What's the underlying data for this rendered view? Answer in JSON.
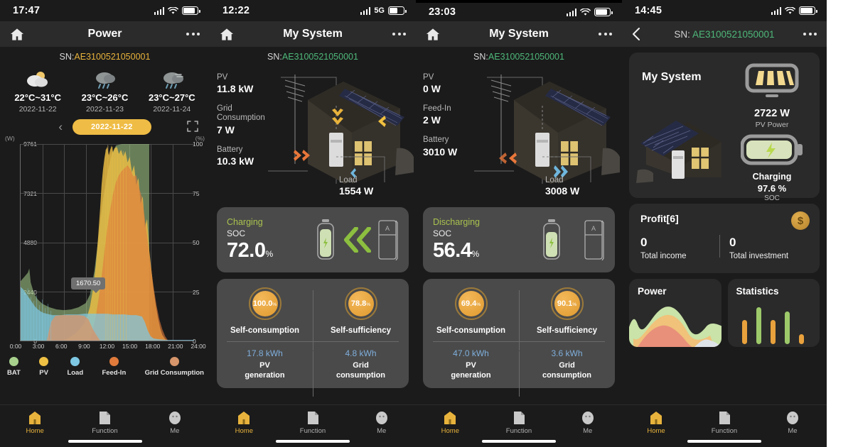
{
  "panels": {
    "power": {
      "status": {
        "time": "17:47",
        "network": "",
        "wifi": true
      },
      "nav": {
        "title": "Power",
        "home_icon": "home-icon",
        "more_icon": "more-icon"
      },
      "sn": {
        "label": "SN:",
        "value": "AE3100521050001"
      },
      "weather": [
        {
          "icon": "partly-cloudy-icon",
          "temp": "22°C~31°C",
          "date": "2022-11-22"
        },
        {
          "icon": "rain-icon",
          "temp": "23°C~26°C",
          "date": "2022-11-23"
        },
        {
          "icon": "rain-wind-icon",
          "temp": "23°C~27°C",
          "date": "2022-11-24"
        }
      ],
      "date_selector": {
        "prev_icon": "chevron-left-icon",
        "value": "2022-11-22",
        "expand_icon": "expand-icon"
      },
      "axis_left_unit": "(W)",
      "axis_right_unit": "(%)",
      "tooltip": "1670.50",
      "legend": [
        {
          "name": "BAT",
          "color": "#a8d08d"
        },
        {
          "name": "PV",
          "color": "#eec044"
        },
        {
          "name": "Load",
          "color": "#7ec8e3"
        },
        {
          "name": "Feed-In",
          "color": "#e07b3c"
        },
        {
          "name": "Grid Consumption",
          "color": "#d6956a"
        }
      ],
      "tabs": [
        {
          "label": "Home",
          "icon": "home-icon",
          "active": true
        },
        {
          "label": "Function",
          "icon": "document-icon",
          "active": false
        },
        {
          "label": "Me",
          "icon": "person-icon",
          "active": false
        }
      ]
    },
    "system_charging": {
      "status": {
        "time": "12:22",
        "network": "5G"
      },
      "nav": {
        "title": "My System"
      },
      "sn": {
        "label": "SN:",
        "value": "AE3100521050001"
      },
      "metrics": [
        {
          "key": "PV",
          "value": "11.8 kW"
        },
        {
          "key": "Grid Consumption",
          "value": "7 W"
        },
        {
          "key": "Battery",
          "value": "10.3 kW"
        }
      ],
      "load": {
        "key": "Load",
        "value": "1554 W"
      },
      "battery_card": {
        "state": "Charging",
        "label": "SOC",
        "value": "72.0",
        "unit": "%"
      },
      "stats": {
        "left": {
          "ring": "100.0",
          "ring_unit": "%",
          "name": "Self-consumption",
          "amount": "17.8 kWh",
          "of": "PV\ngeneration"
        },
        "right": {
          "ring": "78.8",
          "ring_unit": "%",
          "name": "Self-sufficiency",
          "amount": "4.8 kWh",
          "of": "Grid\nconsumption"
        }
      },
      "tabs": [
        {
          "label": "Home",
          "icon": "home-icon",
          "active": true
        },
        {
          "label": "Function",
          "icon": "document-icon",
          "active": false
        },
        {
          "label": "Me",
          "icon": "person-icon",
          "active": false
        }
      ]
    },
    "system_discharging": {
      "status": {
        "time": "23:03",
        "network": ""
      },
      "nav": {
        "title": "My System"
      },
      "sn": {
        "label": "SN:",
        "value": "AE3100521050001"
      },
      "metrics": [
        {
          "key": "PV",
          "value": "0 W"
        },
        {
          "key": "Feed-In",
          "value": "2 W"
        },
        {
          "key": "Battery",
          "value": "3010 W"
        }
      ],
      "load": {
        "key": "Load",
        "value": "3008 W"
      },
      "battery_card": {
        "state": "Discharging",
        "label": "SOC",
        "value": "56.4",
        "unit": "%"
      },
      "stats": {
        "left": {
          "ring": "69.4",
          "ring_unit": "%",
          "name": "Self-consumption",
          "amount": "47.0 kWh",
          "of": "PV\ngeneration"
        },
        "right": {
          "ring": "90.1",
          "ring_unit": "%",
          "name": "Self-sufficiency",
          "amount": "3.6 kWh",
          "of": "Grid\nconsumption"
        }
      },
      "tabs": [
        {
          "label": "Home",
          "icon": "home-icon",
          "active": true
        },
        {
          "label": "Function",
          "icon": "document-icon",
          "active": false
        },
        {
          "label": "Me",
          "icon": "person-icon",
          "active": false
        }
      ]
    },
    "overview": {
      "status": {
        "time": "14:45",
        "network": ""
      },
      "nav": {
        "back_icon": "chevron-left-icon",
        "sn_label": "SN:",
        "sn_value": "AE3100521050001",
        "more_icon": "more-icon"
      },
      "system_card": {
        "title": "My System",
        "pv_power": "2722 W",
        "pv_power_label": "PV Power",
        "battery_state": "Charging",
        "soc": "97.6 %",
        "soc_label": "SOC"
      },
      "profit_card": {
        "title": "Profit[6]",
        "coin_icon": "dollar-coin-icon",
        "income_value": "0",
        "income_label": "Total income",
        "investment_value": "0",
        "investment_label": "Total investment"
      },
      "mini_cards": [
        {
          "title": "Power",
          "icon": "area-chart-icon"
        },
        {
          "title": "Statistics",
          "icon": "bar-chart-icon"
        }
      ],
      "tabs": [
        {
          "label": "Home",
          "icon": "home-icon",
          "active": true
        },
        {
          "label": "Function",
          "icon": "document-icon",
          "active": false
        },
        {
          "label": "Me",
          "icon": "person-icon",
          "active": false
        }
      ]
    }
  },
  "chart_data": {
    "type": "area",
    "title": "Power",
    "xlabel": "",
    "ylabel": "(W)",
    "y2label": "(%)",
    "ylim": [
      0,
      9761
    ],
    "y2lim": [
      0,
      100
    ],
    "yticks": [
      0,
      2440,
      4880,
      7321,
      9761
    ],
    "y2ticks": [
      0,
      25,
      50,
      75,
      100
    ],
    "xticks": [
      "0:00",
      "3:00",
      "6:00",
      "9:00",
      "12:00",
      "15:00",
      "18:00",
      "21:00",
      "24:00"
    ],
    "grid": true,
    "legend_position": "bottom",
    "annotation": "1670.50",
    "series": [
      {
        "name": "BAT",
        "color": "#a8d08d",
        "axis": "right",
        "x": [
          0,
          1,
          2,
          3,
          4,
          5,
          6,
          7,
          8,
          9,
          10,
          11,
          12,
          13,
          14,
          15,
          16,
          17,
          18,
          19,
          20,
          21,
          22,
          23,
          24
        ],
        "values": [
          30,
          26,
          22,
          19,
          17,
          16,
          16,
          16,
          16,
          17,
          24,
          42,
          62,
          80,
          94,
          100,
          100,
          100,
          0,
          0,
          0,
          0,
          0,
          0,
          0
        ]
      },
      {
        "name": "PV",
        "color": "#eec044",
        "axis": "left",
        "x": [
          0,
          1,
          2,
          3,
          4,
          5,
          6,
          7,
          8,
          9,
          10,
          11,
          12,
          13,
          14,
          15,
          16,
          17,
          18,
          19,
          20,
          21,
          22,
          23,
          24
        ],
        "values": [
          0,
          0,
          0,
          0,
          0,
          0,
          50,
          300,
          900,
          2100,
          4200,
          8200,
          9200,
          9400,
          8600,
          6200,
          3200,
          900,
          0,
          0,
          0,
          0,
          0,
          0,
          0
        ]
      },
      {
        "name": "Load",
        "color": "#7ec8e3",
        "axis": "left",
        "x": [
          0,
          1,
          2,
          3,
          4,
          5,
          6,
          7,
          8,
          9,
          10,
          11,
          12,
          13,
          14,
          15,
          16,
          17,
          18,
          19,
          20,
          21,
          22,
          23,
          24
        ],
        "values": [
          2400,
          2300,
          2000,
          1700,
          1500,
          1450,
          1500,
          1500,
          1500,
          1550,
          1600,
          1620,
          1670,
          1650,
          1600,
          1550,
          1500,
          700,
          150,
          120,
          110,
          100,
          100,
          100,
          100
        ]
      },
      {
        "name": "Feed-In",
        "color": "#e07b3c",
        "axis": "left",
        "x": [
          0,
          1,
          2,
          3,
          4,
          5,
          6,
          7,
          8,
          9,
          10,
          11,
          12,
          13,
          14,
          15,
          16,
          17,
          18,
          19,
          20,
          21,
          22,
          23,
          24
        ],
        "values": [
          0,
          0,
          0,
          0,
          0,
          0,
          0,
          0,
          0,
          300,
          1500,
          3000,
          6000,
          7800,
          7200,
          5200,
          2600,
          600,
          0,
          0,
          0,
          0,
          0,
          0,
          0
        ]
      },
      {
        "name": "Grid Consumption",
        "color": "#d6956a",
        "axis": "left",
        "x": [
          0,
          1,
          2,
          3,
          4,
          5,
          6,
          7,
          8,
          9,
          10,
          11,
          12,
          13,
          14,
          15,
          16,
          17,
          18,
          19,
          20,
          21,
          22,
          23,
          24
        ],
        "values": [
          0,
          0,
          0,
          0,
          30,
          900,
          1450,
          1480,
          1500,
          1200,
          300,
          0,
          0,
          0,
          0,
          0,
          0,
          0,
          0,
          0,
          0,
          0,
          0,
          0,
          0
        ]
      }
    ]
  }
}
